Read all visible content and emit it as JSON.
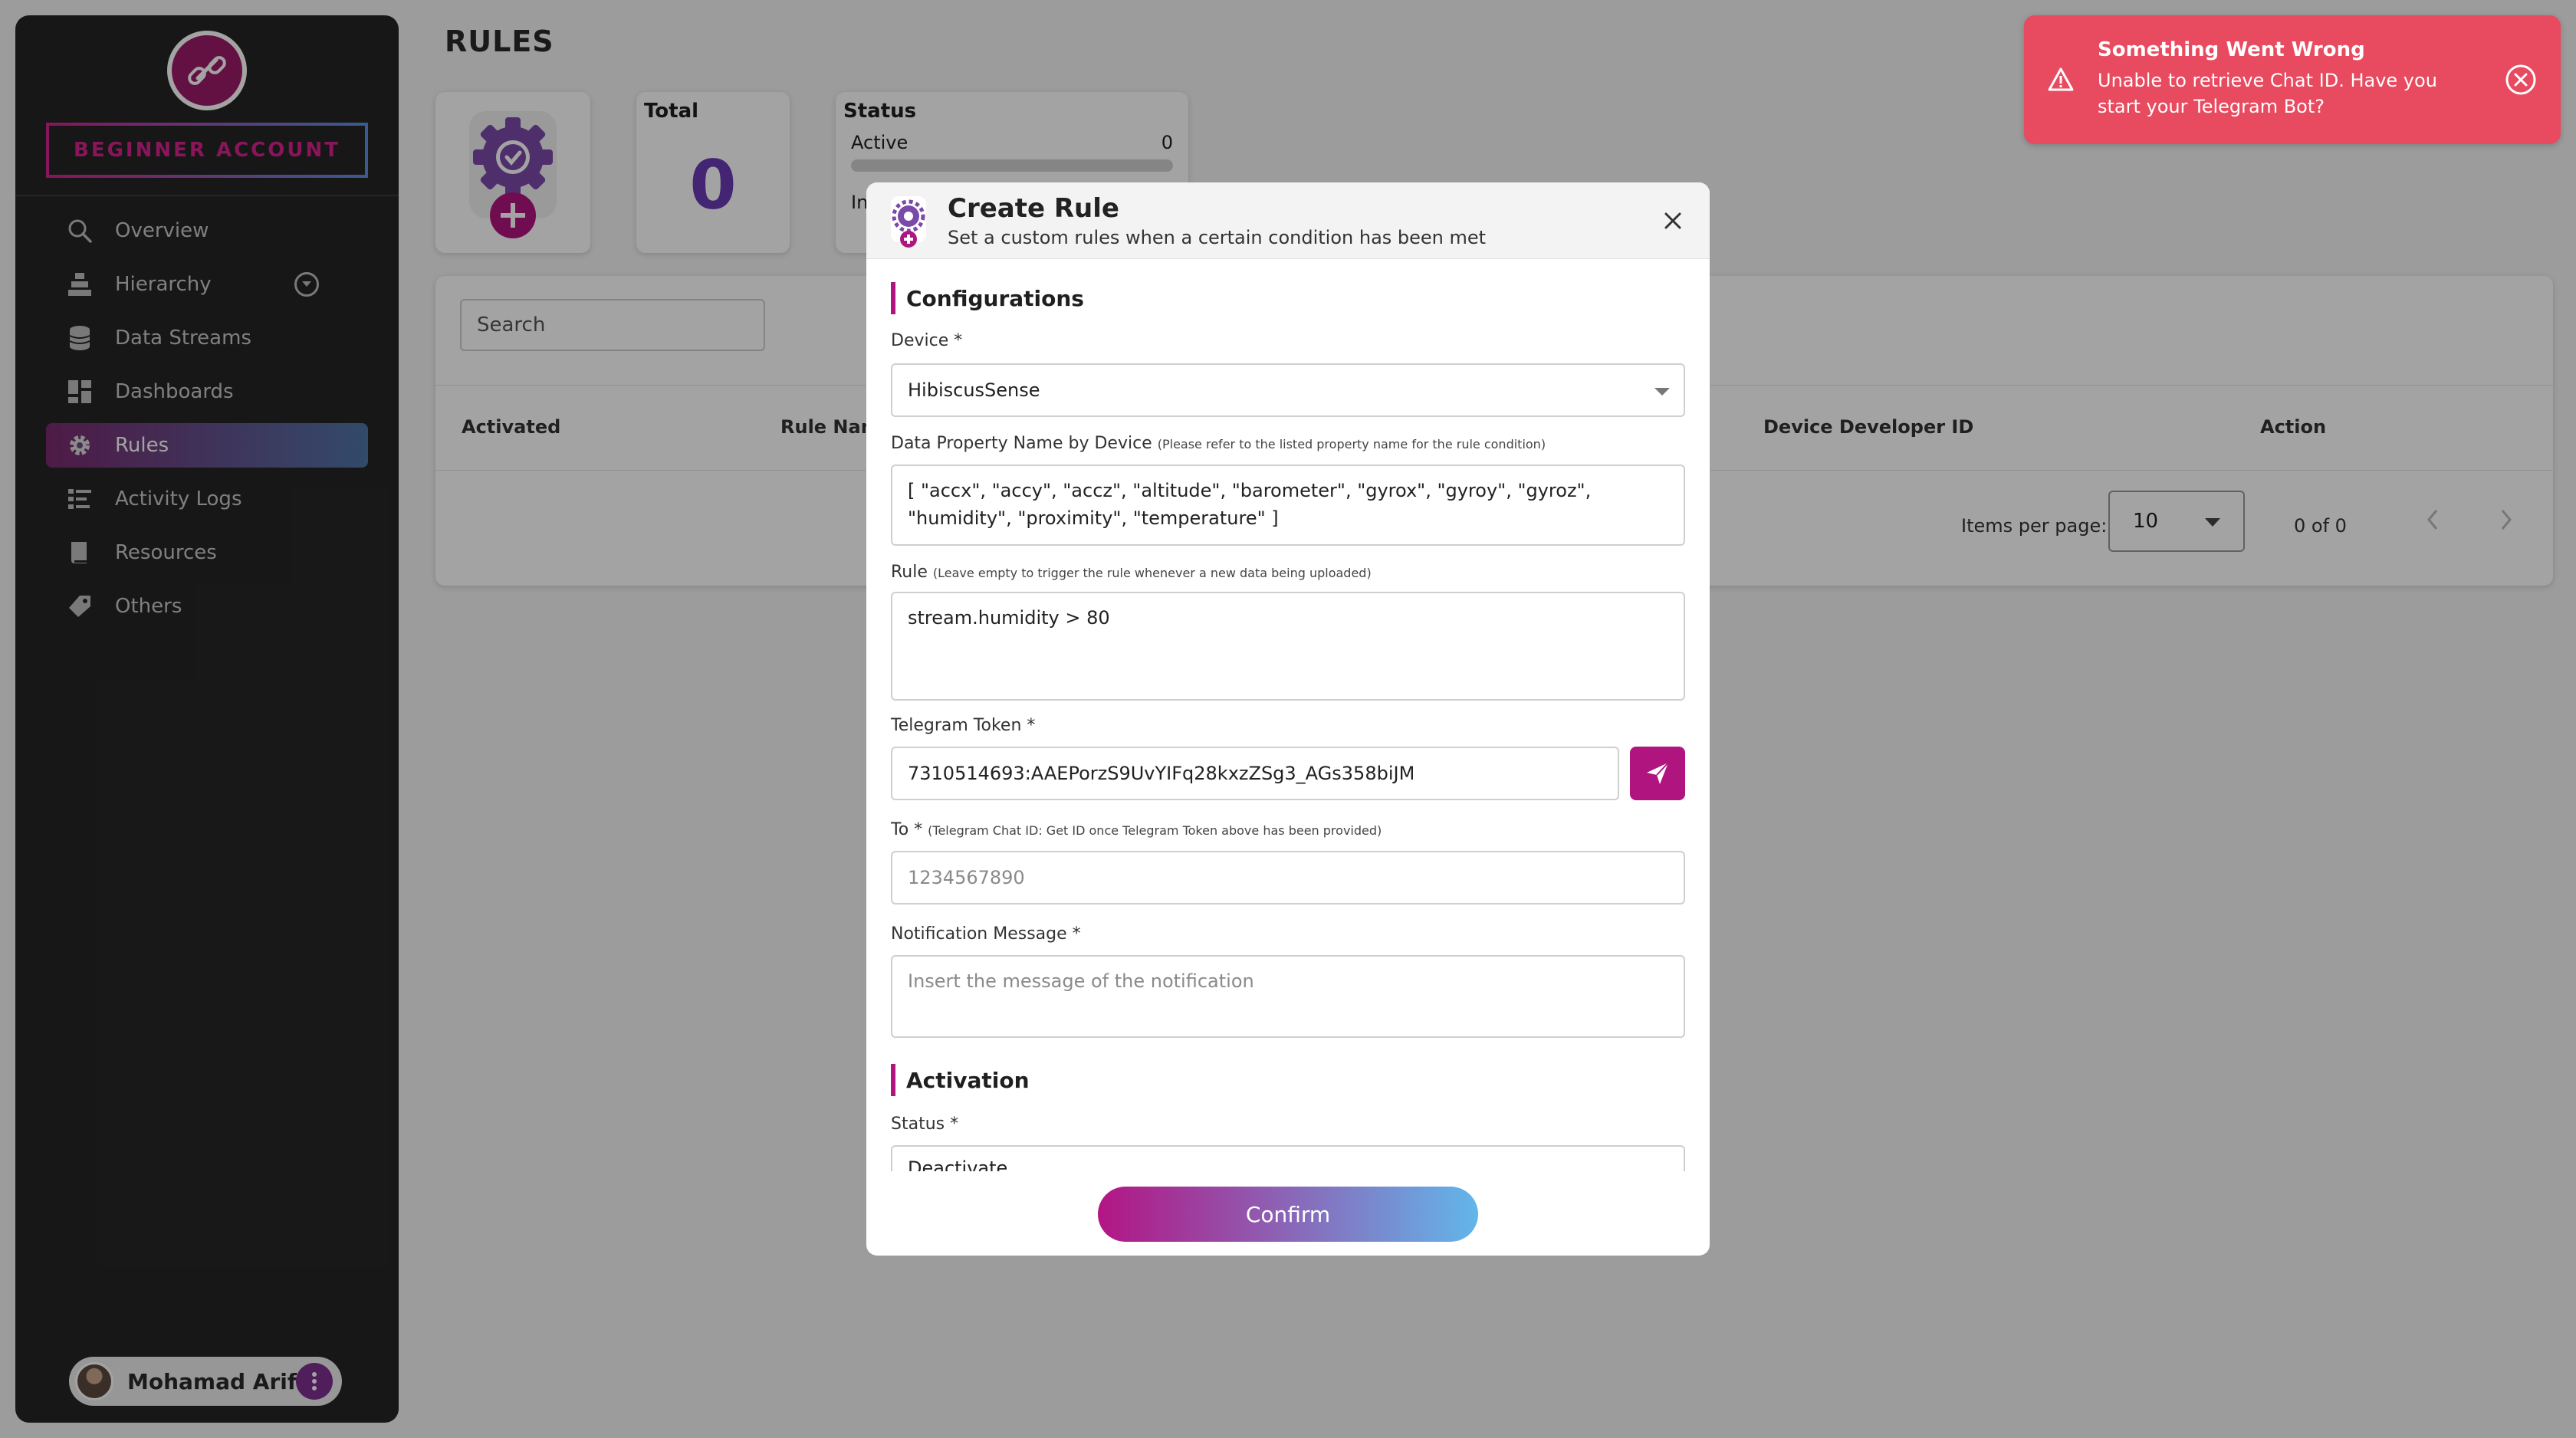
{
  "sidebar": {
    "account_badge": "BEGINNER ACCOUNT",
    "items": [
      {
        "label": "Overview",
        "icon": "search-icon"
      },
      {
        "label": "Hierarchy",
        "icon": "hierarchy-icon"
      },
      {
        "label": "Data Streams",
        "icon": "database-icon"
      },
      {
        "label": "Dashboards",
        "icon": "dashboard-icon"
      },
      {
        "label": "Rules",
        "icon": "gear-icon",
        "active": true
      },
      {
        "label": "Activity Logs",
        "icon": "list-icon"
      },
      {
        "label": "Resources",
        "icon": "book-icon"
      },
      {
        "label": "Others",
        "icon": "tag-icon"
      }
    ],
    "user_name": "Mohamad Ariff"
  },
  "page": {
    "title": "RULES",
    "total_label": "Total",
    "total_value": "0",
    "status_label": "Status",
    "active_label": "Active",
    "active_value": "0",
    "inactive_label": "In"
  },
  "table": {
    "search_placeholder": "Search",
    "columns": [
      "Activated",
      "Rule Name",
      "Device Developer ID",
      "Action"
    ],
    "items_per_page_label": "Items per page:",
    "items_per_page": "10",
    "range": "0 of 0"
  },
  "modal": {
    "title": "Create Rule",
    "subtitle": "Set a custom rules when a certain condition has been met",
    "section_config": "Configurations",
    "device_label": "Device *",
    "device_value": "HibiscusSense",
    "props_label": "Data Property Name by Device",
    "props_hint": "(Please refer to the listed property name for the rule condition)",
    "props_value": "[ \"accx\", \"accy\", \"accz\", \"altitude\", \"barometer\", \"gyrox\", \"gyroy\", \"gyroz\", \"humidity\", \"proximity\", \"temperature\" ]",
    "rule_label": "Rule",
    "rule_hint": "(Leave empty to trigger the rule whenever a new data being uploaded)",
    "rule_value": "stream.humidity > 80",
    "token_label": "Telegram Token *",
    "token_value": "7310514693:AAEPorzS9UvYIFq28kxzZSg3_AGs358biJM",
    "to_label": "To *",
    "to_hint": "(Telegram Chat ID: Get ID once Telegram Token above has been provided)",
    "to_placeholder": "1234567890",
    "message_label": "Notification Message *",
    "message_placeholder": "Insert the message of the notification",
    "section_activation": "Activation",
    "status_label": "Status *",
    "status_value": "Deactivate",
    "confirm": "Confirm"
  },
  "toast": {
    "title": "Something Went Wrong",
    "message": "Unable to retrieve Chat ID. Have you start your Telegram Bot?"
  },
  "colors": {
    "brand": "#b0157f",
    "sidebar_bg": "#252526",
    "toast_bg": "#e84a5f",
    "accent_blue": "#62b6ea"
  }
}
